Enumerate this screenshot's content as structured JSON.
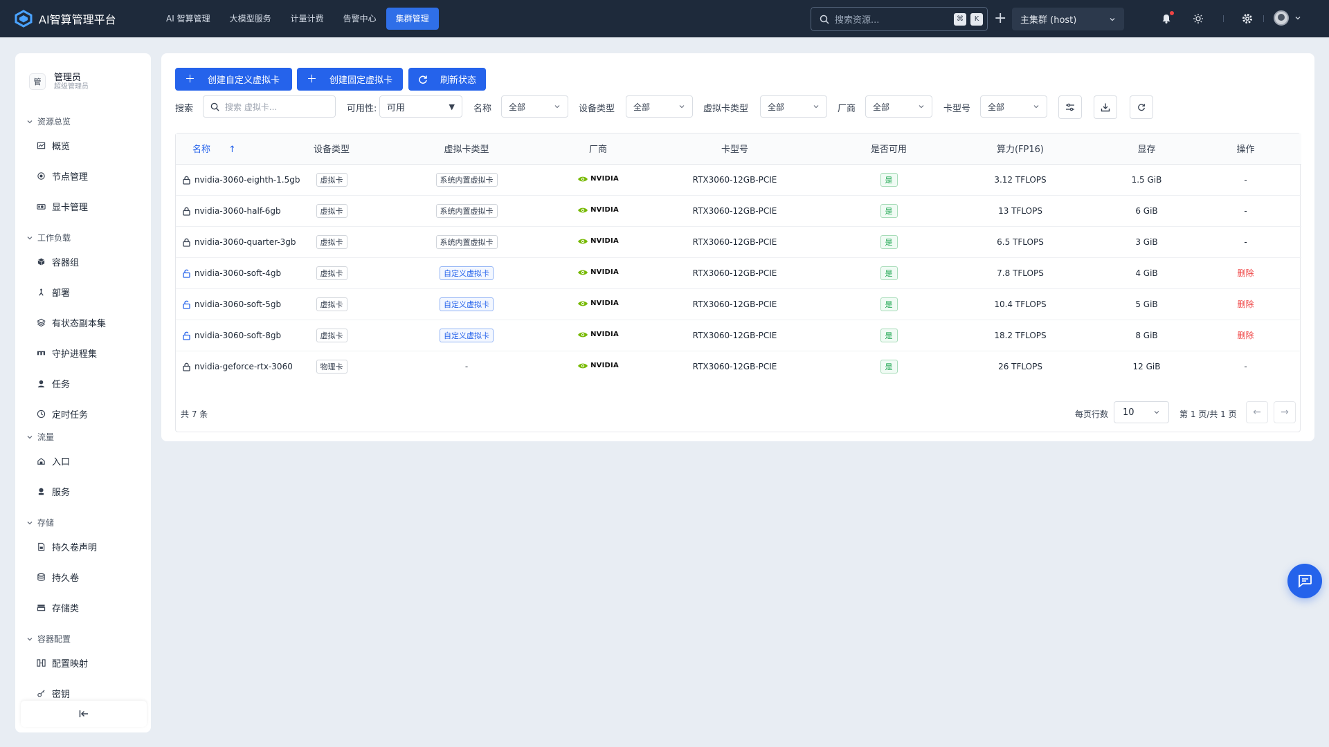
{
  "app": {
    "title": "AI智算管理平台"
  },
  "topnav": [
    {
      "label": "AI 智算管理",
      "active": false
    },
    {
      "label": "大模型服务",
      "active": false
    },
    {
      "label": "计量计费",
      "active": false
    },
    {
      "label": "告警中心",
      "active": false
    },
    {
      "label": "集群管理",
      "active": true
    }
  ],
  "search": {
    "placeholder": "搜索资源...",
    "kbd1": "⌘",
    "kbd2": "K"
  },
  "cluster": {
    "selected": "主集群 (host)"
  },
  "user": {
    "badge": "管",
    "name": "管理员",
    "role": "超级管理员"
  },
  "sidebar": {
    "groups": [
      {
        "label": "资源总览",
        "items": [
          {
            "label": "概览",
            "icon": "dashboard-icon"
          },
          {
            "label": "节点管理",
            "icon": "node-icon"
          },
          {
            "label": "显卡管理",
            "icon": "gpu-icon"
          }
        ]
      },
      {
        "label": "工作负载",
        "items": [
          {
            "label": "容器组",
            "icon": "pod-icon"
          },
          {
            "label": "部署",
            "icon": "deploy-icon"
          },
          {
            "label": "有状态副本集",
            "icon": "statefulset-icon"
          },
          {
            "label": "守护进程集",
            "icon": "daemonset-icon"
          },
          {
            "label": "任务",
            "icon": "job-icon"
          },
          {
            "label": "定时任务",
            "icon": "cronjob-icon"
          }
        ]
      },
      {
        "label": "流量",
        "items": [
          {
            "label": "入口",
            "icon": "ingress-icon"
          },
          {
            "label": "服务",
            "icon": "service-icon"
          }
        ]
      },
      {
        "label": "存储",
        "items": [
          {
            "label": "持久卷声明",
            "icon": "pvc-icon"
          },
          {
            "label": "持久卷",
            "icon": "pv-icon"
          },
          {
            "label": "存储类",
            "icon": "storageclass-icon"
          }
        ]
      },
      {
        "label": "容器配置",
        "items": [
          {
            "label": "配置映射",
            "icon": "configmap-icon"
          },
          {
            "label": "密钥",
            "icon": "secret-icon"
          }
        ]
      }
    ]
  },
  "toolbar": {
    "create_custom": "创建自定义虚拟卡",
    "create_fixed": "创建固定虚拟卡",
    "refresh": "刷新状态"
  },
  "filters": {
    "search_label": "搜索",
    "search_placeholder": "搜索 虚拟卡...",
    "availability_label": "可用性:",
    "availability_value": "可用",
    "name_label": "名称",
    "name_value": "全部",
    "device_type_label": "设备类型",
    "device_type_value": "全部",
    "vcard_type_label": "虚拟卡类型",
    "vcard_type_value": "全部",
    "vendor_label": "厂商",
    "vendor_value": "全部",
    "model_label": "卡型号",
    "model_value": "全部"
  },
  "table": {
    "columns": [
      "名称",
      "设备类型",
      "虚拟卡类型",
      "厂商",
      "卡型号",
      "是否可用",
      "算力(FP16)",
      "显存",
      "操作"
    ],
    "sort_indicator": "↑",
    "rows": [
      {
        "name": "nvidia-3060-eighth-1.5gb",
        "locked": true,
        "device_type": "虚拟卡",
        "vcard_type": "系统内置虚拟卡",
        "vcard_style": "plain",
        "vendor": "NVIDIA",
        "model": "RTX3060-12GB-PCIE",
        "available": "是",
        "compute": "3.12 TFLOPS",
        "memory": "1.5 GiB",
        "action": "-"
      },
      {
        "name": "nvidia-3060-half-6gb",
        "locked": true,
        "device_type": "虚拟卡",
        "vcard_type": "系统内置虚拟卡",
        "vcard_style": "plain",
        "vendor": "NVIDIA",
        "model": "RTX3060-12GB-PCIE",
        "available": "是",
        "compute": "13 TFLOPS",
        "memory": "6 GiB",
        "action": "-"
      },
      {
        "name": "nvidia-3060-quarter-3gb",
        "locked": true,
        "device_type": "虚拟卡",
        "vcard_type": "系统内置虚拟卡",
        "vcard_style": "plain",
        "vendor": "NVIDIA",
        "model": "RTX3060-12GB-PCIE",
        "available": "是",
        "compute": "6.5 TFLOPS",
        "memory": "3 GiB",
        "action": "-"
      },
      {
        "name": "nvidia-3060-soft-4gb",
        "locked": false,
        "device_type": "虚拟卡",
        "vcard_type": "自定义虚拟卡",
        "vcard_style": "blue",
        "vendor": "NVIDIA",
        "model": "RTX3060-12GB-PCIE",
        "available": "是",
        "compute": "7.8 TFLOPS",
        "memory": "4 GiB",
        "action": "删除"
      },
      {
        "name": "nvidia-3060-soft-5gb",
        "locked": false,
        "device_type": "虚拟卡",
        "vcard_type": "自定义虚拟卡",
        "vcard_style": "blue",
        "vendor": "NVIDIA",
        "model": "RTX3060-12GB-PCIE",
        "available": "是",
        "compute": "10.4 TFLOPS",
        "memory": "5 GiB",
        "action": "删除"
      },
      {
        "name": "nvidia-3060-soft-8gb",
        "locked": false,
        "device_type": "虚拟卡",
        "vcard_type": "自定义虚拟卡",
        "vcard_style": "blue",
        "vendor": "NVIDIA",
        "model": "RTX3060-12GB-PCIE",
        "available": "是",
        "compute": "18.2 TFLOPS",
        "memory": "8 GiB",
        "action": "删除"
      },
      {
        "name": "nvidia-geforce-rtx-3060",
        "locked": true,
        "device_type": "物理卡",
        "vcard_type": "-",
        "vcard_style": "none",
        "vendor": "NVIDIA",
        "model": "RTX3060-12GB-PCIE",
        "available": "是",
        "compute": "26 TFLOPS",
        "memory": "12 GiB",
        "action": "-"
      }
    ]
  },
  "pagination": {
    "total": "共 7 条",
    "rows_per_page_label": "每页行数",
    "rows_per_page": "10",
    "page_info": "第 1 页/共 1 页",
    "prev": "←",
    "next": "→"
  },
  "colors": {
    "topbar": "#1e2a3b",
    "accent": "#2563eb",
    "danger": "#ef4444",
    "success": "#16a34a"
  }
}
